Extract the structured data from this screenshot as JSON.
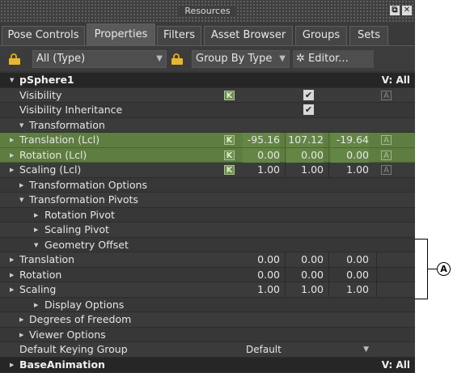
{
  "window": {
    "title": "Resources",
    "detach_glyph": "⧉",
    "close_glyph": "✕"
  },
  "tabs": [
    {
      "label": "Pose Controls",
      "active": false
    },
    {
      "label": "Properties",
      "active": true
    },
    {
      "label": "Filters",
      "active": false
    },
    {
      "label": "Asset Browser",
      "active": false
    },
    {
      "label": "Groups",
      "active": false
    },
    {
      "label": "Sets",
      "active": false
    }
  ],
  "toolbar": {
    "type_filter": "All (Type)",
    "group_by": "Group By Type",
    "editor": "✲ Editor..."
  },
  "glyphs": {
    "collapsed": "▶",
    "expanded": "▼",
    "dropdown": "▼",
    "check": "✔",
    "key": "K",
    "anim": "A"
  },
  "properties": {
    "object_name": "pSphere1",
    "object_visibility": "V: All",
    "visibility": "Visibility",
    "visibility_inheritance": "Visibility Inheritance",
    "transformation": "Transformation",
    "translation_lcl": {
      "label": "Translation (Lcl)",
      "x": "-95.16",
      "y": "107.12",
      "z": "-19.64"
    },
    "rotation_lcl": {
      "label": "Rotation (Lcl)",
      "x": "0.00",
      "y": "0.00",
      "z": "0.00"
    },
    "scaling_lcl": {
      "label": "Scaling (Lcl)",
      "x": "1.00",
      "y": "1.00",
      "z": "1.00"
    },
    "transformation_options": "Transformation Options",
    "transformation_pivots": "Transformation Pivots",
    "rotation_pivot": "Rotation Pivot",
    "scaling_pivot": "Scaling Pivot",
    "geometry_offset": "Geometry Offset",
    "translation": {
      "label": "Translation",
      "x": "0.00",
      "y": "0.00",
      "z": "0.00"
    },
    "rotation": {
      "label": "Rotation",
      "x": "0.00",
      "y": "0.00",
      "z": "0.00"
    },
    "scaling": {
      "label": "Scaling",
      "x": "1.00",
      "y": "1.00",
      "z": "1.00"
    },
    "display_options": "Display Options",
    "degrees_of_freedom": "Degrees of Freedom",
    "viewer_options": "Viewer Options",
    "default_keying_group": {
      "label": "Default Keying Group",
      "value": "Default"
    },
    "base_animation": "BaseAnimation",
    "base_animation_visibility": "V: All"
  },
  "callout": {
    "label": "A"
  },
  "colors": {
    "keyed_row": "#5e7d40",
    "panel": "#444444",
    "lock": "#e8b730"
  }
}
